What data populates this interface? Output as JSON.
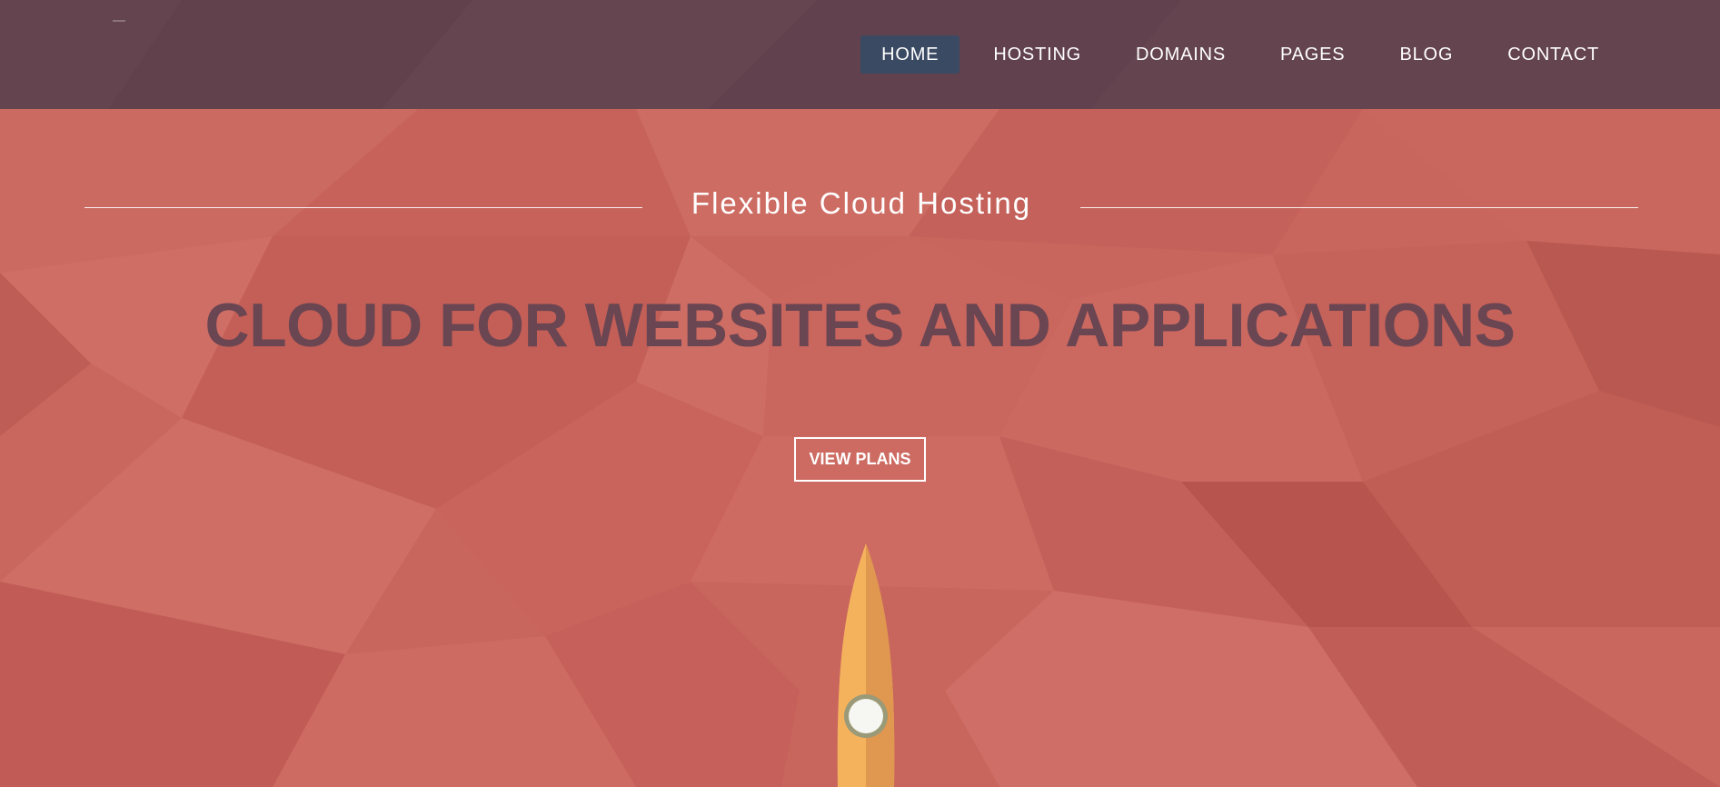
{
  "nav": {
    "items": [
      {
        "label": "HOME",
        "active": true
      },
      {
        "label": "HOSTING",
        "active": false
      },
      {
        "label": "DOMAINS",
        "active": false
      },
      {
        "label": "PAGES",
        "active": false
      },
      {
        "label": "BLOG",
        "active": false
      },
      {
        "label": "CONTACT",
        "active": false
      }
    ]
  },
  "hero": {
    "subtitle": "Flexible Cloud Hosting",
    "headline": "CLOUD FOR WEBSITES AND APPLICATIONS",
    "cta_label": "VIEW PLANS"
  },
  "colors": {
    "topbar": "#60424e",
    "hero_bg": "#c8655c",
    "active_nav": "#3a4a63",
    "headline": "#6a4552",
    "rocket_body": "#f5b25c"
  },
  "icons": {
    "illustration": "rocket-icon"
  }
}
